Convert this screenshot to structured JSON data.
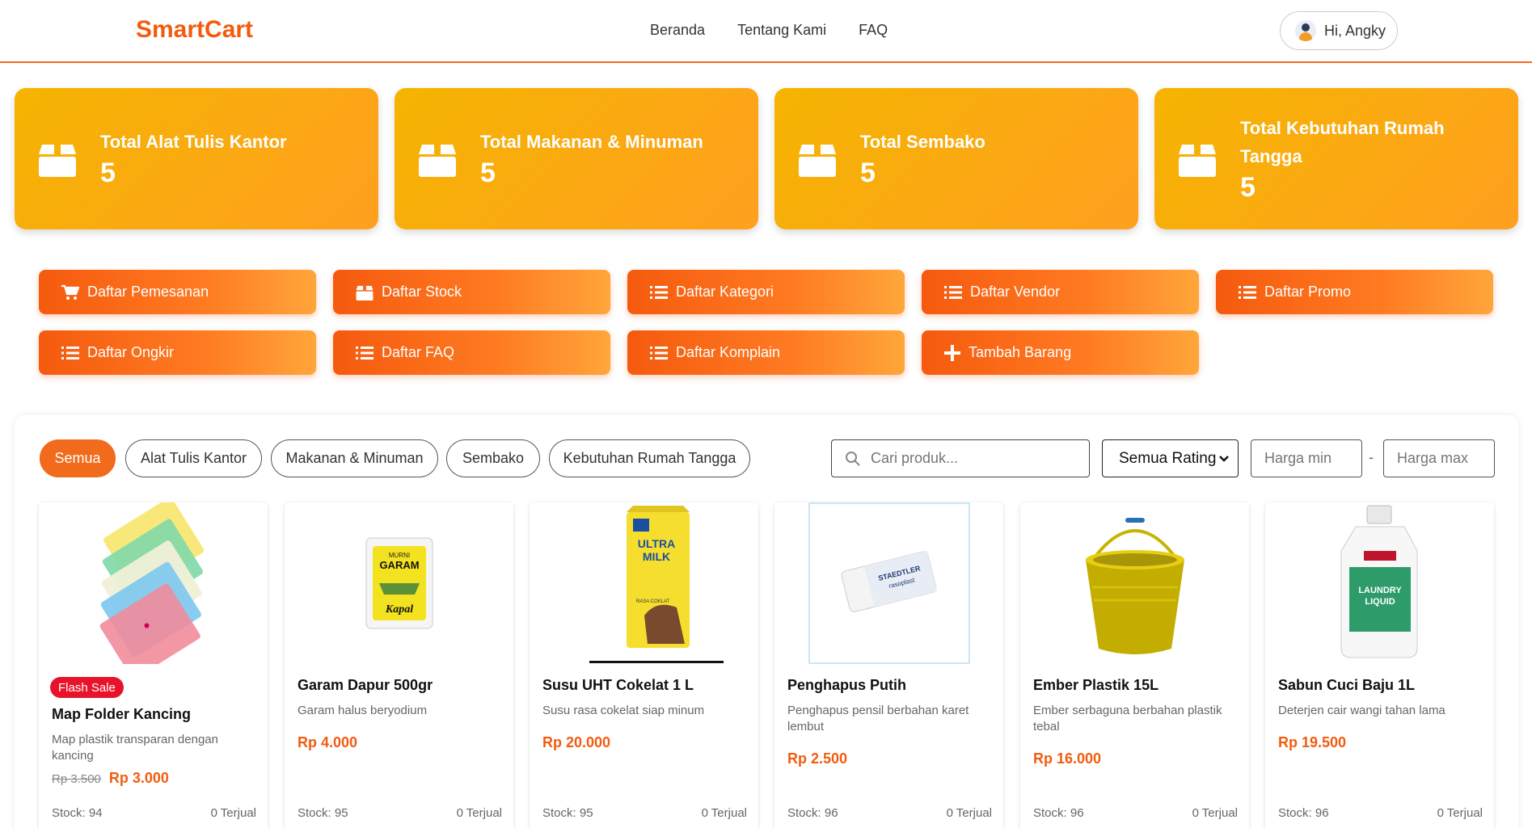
{
  "header": {
    "logo": "SmartCart",
    "nav": [
      "Beranda",
      "Tentang Kami",
      "FAQ"
    ],
    "user_greeting": "Hi, Angky"
  },
  "stats": [
    {
      "label": "Total Alat Tulis Kantor",
      "value": "5",
      "icon": "box-icon"
    },
    {
      "label": "Total Makanan & Minuman",
      "value": "5",
      "icon": "box-icon"
    },
    {
      "label": "Total Sembako",
      "value": "5",
      "icon": "box-icon"
    },
    {
      "label": "Total Kebutuhan Rumah Tangga",
      "value": "5",
      "icon": "box-icon"
    }
  ],
  "admin_buttons": [
    {
      "label": "Daftar Pemesanan",
      "icon": "cart-icon"
    },
    {
      "label": "Daftar Stock",
      "icon": "box-icon"
    },
    {
      "label": "Daftar Kategori",
      "icon": "list-icon"
    },
    {
      "label": "Daftar Vendor",
      "icon": "list-icon"
    },
    {
      "label": "Daftar Promo",
      "icon": "list-icon"
    },
    {
      "label": "Daftar Ongkir",
      "icon": "list-icon"
    },
    {
      "label": "Daftar FAQ",
      "icon": "list-icon"
    },
    {
      "label": "Daftar Komplain",
      "icon": "list-icon"
    },
    {
      "label": "Tambah Barang",
      "icon": "plus-icon"
    }
  ],
  "filters": {
    "categories": [
      "Semua",
      "Alat Tulis Kantor",
      "Makanan & Minuman",
      "Sembako",
      "Kebutuhan Rumah Tangga"
    ],
    "active": "Semua",
    "search_placeholder": "Cari produk...",
    "rating_selected": "Semua Rating",
    "price_min_placeholder": "Harga min",
    "price_max_placeholder": "Harga max",
    "range_separator": "-"
  },
  "products": [
    {
      "name": "Map Folder Kancing",
      "desc": "Map plastik transparan dengan kancing",
      "old_price": "Rp 3.500",
      "price": "Rp 3.000",
      "badge": "Flash Sale",
      "stock": "Stock: 94",
      "sold": "0 Terjual",
      "image": "folder-image"
    },
    {
      "name": "Garam Dapur 500gr",
      "desc": "Garam halus beryodium",
      "price": "Rp 4.000",
      "stock": "Stock: 95",
      "sold": "0 Terjual",
      "image": "salt-image",
      "image_text": [
        "MURNI",
        "GARAM",
        "Kapal"
      ]
    },
    {
      "name": "Susu UHT Cokelat 1 L",
      "desc": "Susu rasa cokelat siap minum",
      "price": "Rp 20.000",
      "stock": "Stock: 95",
      "sold": "0 Terjual",
      "image": "milk-image",
      "image_text": [
        "ULTRA",
        "MILK",
        "RASA COKLAT"
      ]
    },
    {
      "name": "Penghapus Putih",
      "desc": "Penghapus pensil berbahan karet lembut",
      "price": "Rp 2.500",
      "stock": "Stock: 96",
      "sold": "0 Terjual",
      "image": "eraser-image",
      "image_text": [
        "STAEDTLER",
        "rasoplast"
      ]
    },
    {
      "name": "Ember Plastik 15L",
      "desc": "Ember serbaguna berbahan plastik tebal",
      "price": "Rp 16.000",
      "stock": "Stock: 96",
      "sold": "0 Terjual",
      "image": "bucket-image"
    },
    {
      "name": "Sabun Cuci Baju 1L",
      "desc": "Deterjen cair wangi tahan lama",
      "price": "Rp 19.500",
      "stock": "Stock: 96",
      "sold": "0 Terjual",
      "image": "detergent-image",
      "image_text": [
        "LAUNDRY",
        "LIQUID"
      ]
    }
  ],
  "colors": {
    "accent": "#f26a1b",
    "stat_gradient_start": "#f5b400",
    "stat_gradient_end": "#ffa020",
    "flash_badge": "#e8132a",
    "price": "#f25c0f"
  }
}
